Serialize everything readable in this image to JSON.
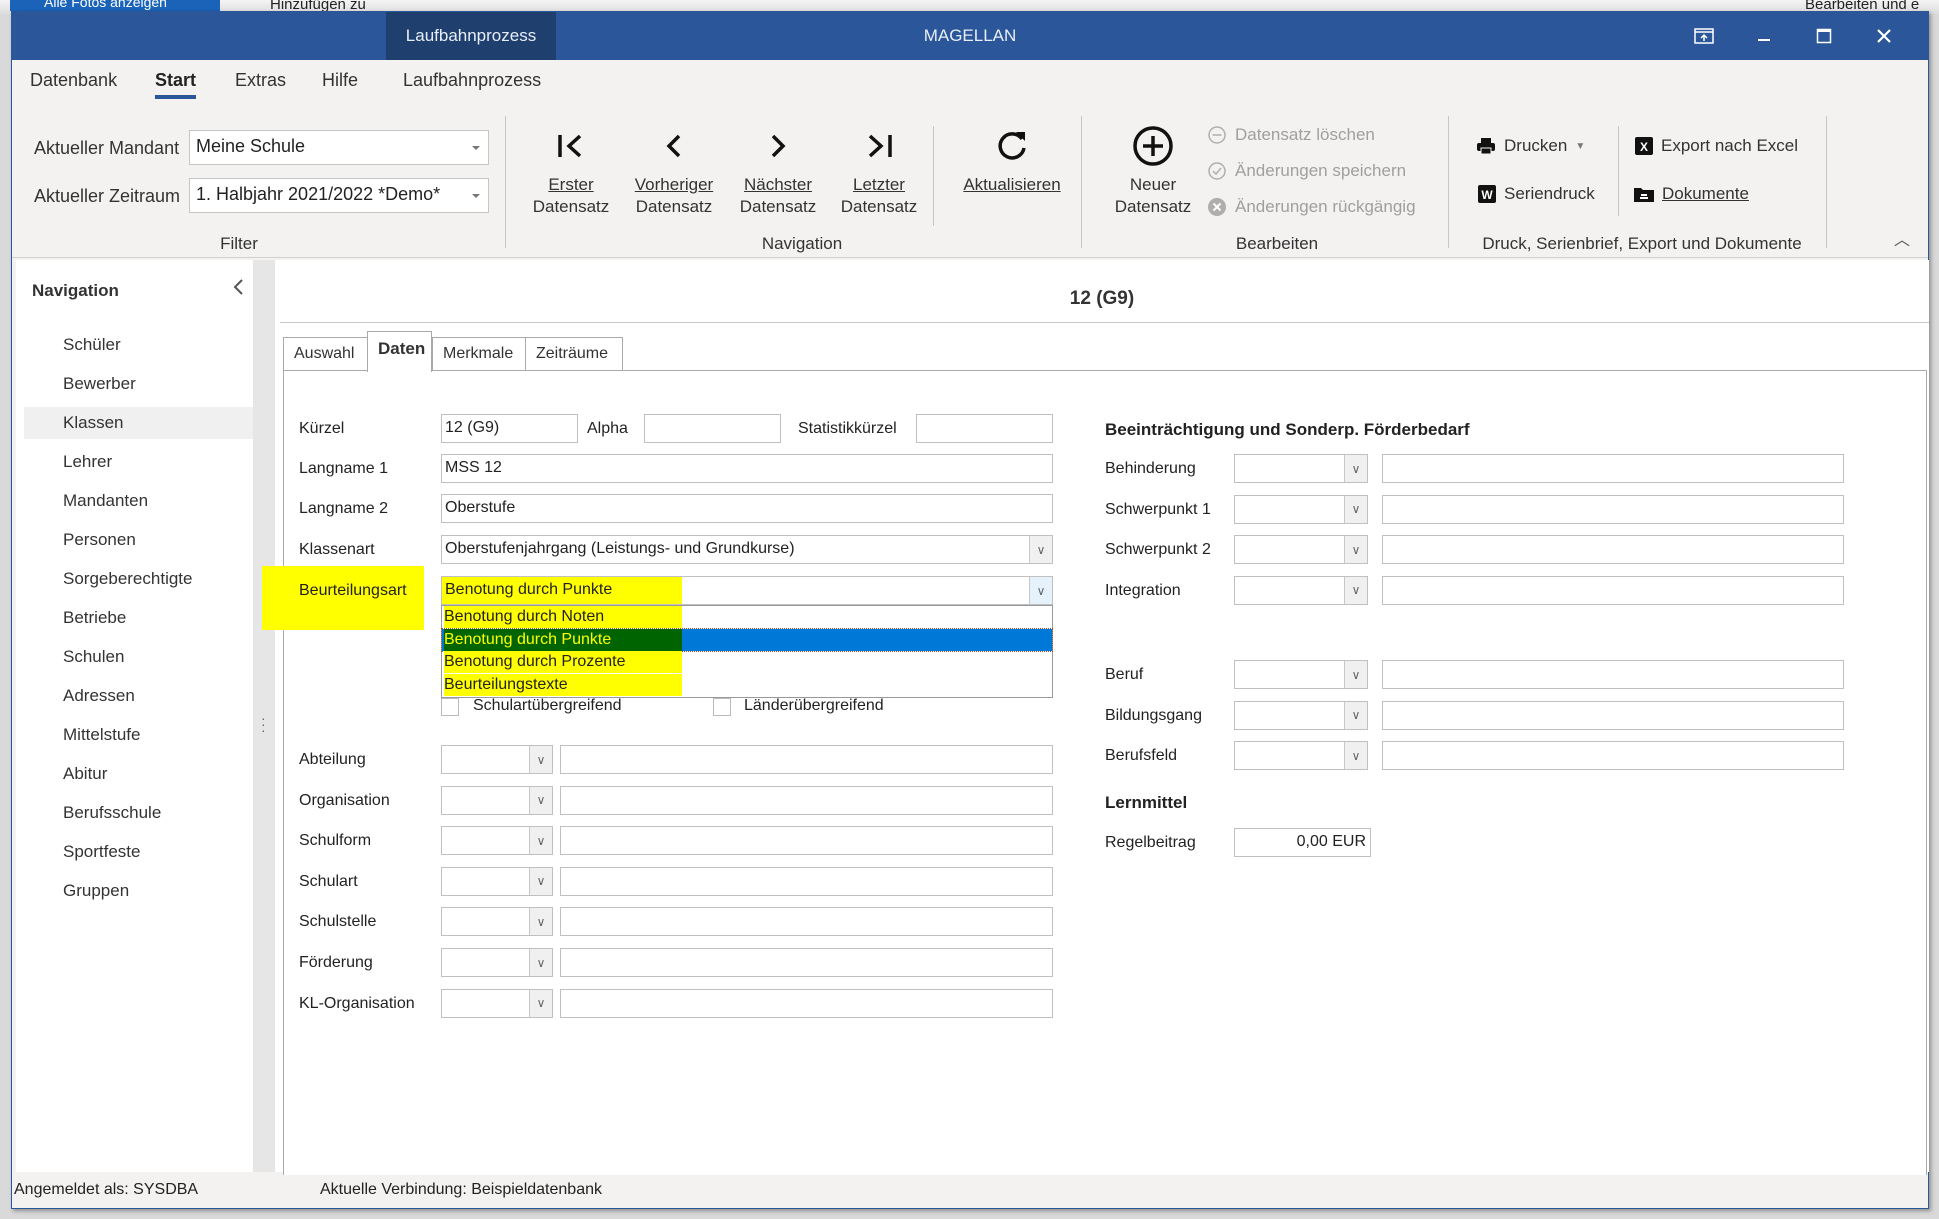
{
  "background": {
    "button_label": "Alle Fotos anzeigen",
    "text_left": "Hinzufügen zu",
    "text_right": "Bearbeiten und e"
  },
  "window": {
    "app_title": "MAGELLAN",
    "contextual_tab": "Laufbahnprozess"
  },
  "menu": {
    "items": [
      "Datenbank",
      "Start",
      "Extras",
      "Hilfe",
      "Laufbahnprozess"
    ],
    "active": "Start"
  },
  "ribbon": {
    "filter": {
      "mandant_label": "Aktueller Mandant",
      "mandant_value": "Meine Schule",
      "zeitraum_label": "Aktueller Zeitraum",
      "zeitraum_value": "1. Halbjahr 2021/2022 *Demo*",
      "caption": "Filter"
    },
    "navigation": {
      "first_l1": "Erster",
      "first_l2": "Datensatz",
      "prev_l1": "Vorheriger",
      "prev_l2": "Datensatz",
      "next_l1": "Nächster",
      "next_l2": "Datensatz",
      "last_l1": "Letzter",
      "last_l2": "Datensatz",
      "refresh": "Aktualisieren",
      "caption": "Navigation"
    },
    "bearbeiten": {
      "new_l1": "Neuer",
      "new_l2": "Datensatz",
      "delete": "Datensatz löschen",
      "save": "Änderungen speichern",
      "undo": "Änderungen rückgängig",
      "caption": "Bearbeiten"
    },
    "druck": {
      "print": "Drucken",
      "mailmerge": "Seriendruck",
      "excel": "Export nach Excel",
      "documents": "Dokumente",
      "caption": "Druck, Serienbrief, Export und Dokumente"
    }
  },
  "nav": {
    "title": "Navigation",
    "items": [
      "Schüler",
      "Bewerber",
      "Klassen",
      "Lehrer",
      "Mandanten",
      "Personen",
      "Sorgeberechtigte",
      "Betriebe",
      "Schulen",
      "Adressen",
      "Mittelstufe",
      "Abitur",
      "Berufsschule",
      "Sportfeste",
      "Gruppen"
    ],
    "selected": "Klassen"
  },
  "record": {
    "title": "12 (G9)",
    "tabs": [
      "Auswahl",
      "Daten",
      "Merkmale",
      "Zeiträume"
    ],
    "active_tab": "Daten"
  },
  "form": {
    "kuerzel_label": "Kürzel",
    "kuerzel_value": "12 (G9)",
    "alpha_label": "Alpha",
    "alpha_value": "",
    "statistik_label": "Statistikkürzel",
    "statistik_value": "",
    "langname1_label": "Langname 1",
    "langname1_value": "MSS 12",
    "langname2_label": "Langname 2",
    "langname2_value": "Oberstufe",
    "klassenart_label": "Klassenart",
    "klassenart_value": "Oberstufenjahrgang (Leistungs- und Grundkurse)",
    "beurteilungsart_label": "Beurteilungsart",
    "beurteilungsart_value": "Benotung durch Punkte",
    "beurteilungsart_options": [
      "Benotung durch Noten",
      "Benotung durch Punkte",
      "Benotung durch Prozente",
      "Beurteilungstexte"
    ],
    "beurteilungsart_selected_index": 1,
    "schulart_uebergreifend_label": "Schulartübergreifend",
    "schulart_uebergreifend_checked": false,
    "laender_uebergreifend_label": "Länderübergreifend",
    "laender_uebergreifend_checked": false,
    "left_lookups": [
      "Abteilung",
      "Organisation",
      "Schulform",
      "Schulart",
      "Schulstelle",
      "Förderung",
      "KL-Organisation"
    ],
    "impairment_title": "Beeinträchtigung und Sonderp. Förderbedarf",
    "impairment_lookups": [
      "Behinderung",
      "Schwerpunkt 1",
      "Schwerpunkt 2",
      "Integration"
    ],
    "career_lookups": [
      "Beruf",
      "Bildungsgang",
      "Berufsfeld"
    ],
    "lernmittel_title": "Lernmittel",
    "regelbeitrag_label": "Regelbeitrag",
    "regelbeitrag_value": "0,00 EUR"
  },
  "status": {
    "user": "Angemeldet als: SYSDBA",
    "connection": "Aktuelle Verbindung: Beispieldatenbank"
  },
  "colors": {
    "titlebar": "#2b579a",
    "contextual_tab": "#1f3f6e",
    "highlight": "#ffff00",
    "selection": "#0078d7"
  }
}
